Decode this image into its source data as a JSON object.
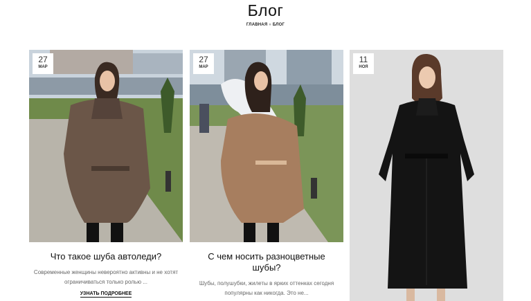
{
  "header": {
    "title": "Блог",
    "breadcrumb": {
      "home": "Главная",
      "separator": "»",
      "current": "Блог"
    }
  },
  "posts": [
    {
      "day": "27",
      "month": "мар",
      "title": "Что такое шуба автоледи?",
      "excerpt": "Современные женщины невероятно активны и не хотят ограничиваться только ролью ...",
      "read_more": "Узнать подробнее",
      "image_icon": "woman-in-brown-mink-coat-photo"
    },
    {
      "day": "27",
      "month": "мар",
      "title": "С чем носить разноцветные шубы?",
      "excerpt": "Шубы, полушубки, жилеты в ярких оттенках сегодня популярны как никогда. Это не...",
      "image_icon": "woman-in-fur-coat-with-white-collar-photo"
    },
    {
      "day": "11",
      "month": "ноя",
      "image_icon": "woman-in-long-black-mink-coat-photo"
    }
  ],
  "colors": {
    "accent": "#111111",
    "excerpt": "#666666",
    "badge_bg": "#ffffff"
  }
}
